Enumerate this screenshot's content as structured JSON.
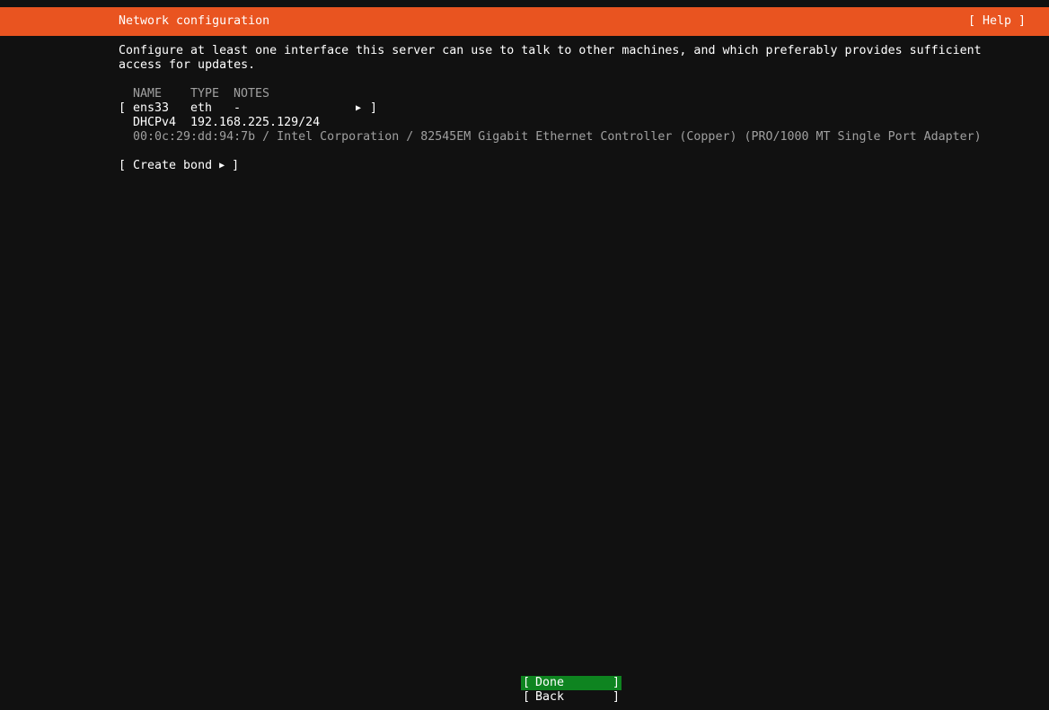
{
  "header": {
    "title": "Network configuration",
    "help_label": "[ Help ]"
  },
  "description": {
    "line1": "Configure at least one interface this server can use to talk to other machines, and which preferably provides sufficient",
    "line2": "access for updates."
  },
  "table": {
    "columns": [
      "NAME",
      "TYPE",
      "NOTES"
    ],
    "interface": {
      "name": "ens33",
      "type": "eth",
      "notes": "-",
      "address_method": "DHCPv4",
      "address": "192.168.225.129/24",
      "hardware": "00:0c:29:dd:94:7b / Intel Corporation / 82545EM Gigabit Ethernet Controller (Copper) (PRO/1000 MT Single Port Adapter)"
    }
  },
  "create_bond_label": "Create bond",
  "buttons": {
    "done": "Done",
    "back": "Back"
  },
  "colors": {
    "header_bg": "#e95420",
    "background": "#111111",
    "done_bg": "#0e8420",
    "dim_text": "#a0a0a0"
  },
  "icons": {
    "arrow": "triangle-right"
  }
}
